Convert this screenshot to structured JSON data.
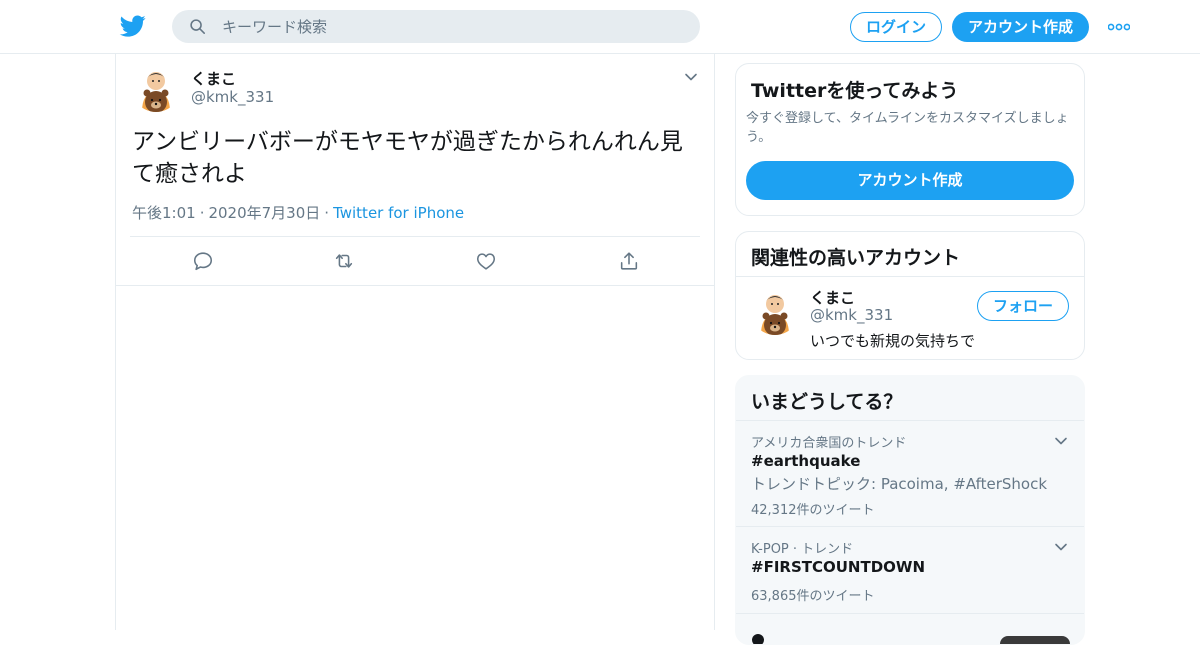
{
  "header": {
    "search_placeholder": "キーワード検索",
    "login_label": "ログイン",
    "signup_label": "アカウント作成"
  },
  "tweet": {
    "author_name": "くまこ",
    "author_handle": "@kmk_331",
    "text": "アンビリーバボーがモヤモヤが過ぎたかられんれん見て癒されよ",
    "time": "午後1:01",
    "date": "2020年7月30日",
    "source": "Twitter for iPhone"
  },
  "sidebar": {
    "signup_card": {
      "title": "Twitterを使ってみよう",
      "description": "今すぐ登録して、タイムラインをカスタマイズしましょう。",
      "button_label": "アカウント作成"
    },
    "related_card": {
      "title": "関連性の高いアカウント",
      "name": "くまこ",
      "handle": "@kmk_331",
      "bio": "いつでも新規の気持ちで",
      "follow_label": "フォロー"
    },
    "trends_card": {
      "title": "いまどうしてる？",
      "trends": [
        {
          "context": "アメリカ合衆国のトレンド",
          "tag": "#earthquake",
          "topics": "トレンドトピック: Pacoima, #AfterShock",
          "count": "42,312件のツイート"
        },
        {
          "context": "K-POP · トレンド",
          "tag": "#FIRSTCOUNTDOWN",
          "count": "63,865件のツイート"
        }
      ]
    }
  },
  "colors": {
    "brand": "#1da1f2",
    "link": "#1b95e0",
    "secondary_text": "#657786",
    "divider": "#e6ecf0"
  }
}
